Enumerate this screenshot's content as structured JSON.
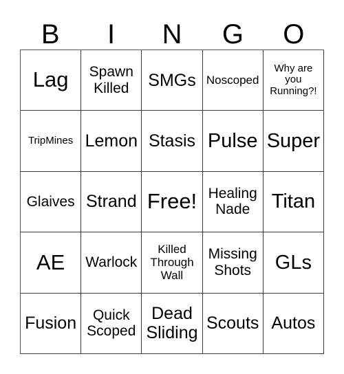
{
  "card": {
    "title": "BINGO",
    "header_letters": [
      "B",
      "I",
      "N",
      "G",
      "O"
    ],
    "colors": {
      "background": "#ffffff",
      "text": "#000000",
      "grid_line": "#3a3a3a"
    },
    "rows": 5,
    "columns": 5,
    "cells": [
      {
        "text": "Lag",
        "size": "fs-xxl"
      },
      {
        "text": "Spawn\nKilled",
        "size": "fs-md"
      },
      {
        "text": "SMGs",
        "size": "fs-lg"
      },
      {
        "text": "Noscoped",
        "size": "fs-sm"
      },
      {
        "text": "Why are\nyou\nRunning?!",
        "size": "fs-xs"
      },
      {
        "text": "TripMines",
        "size": "fs-xs"
      },
      {
        "text": "Lemon",
        "size": "fs-lg"
      },
      {
        "text": "Stasis",
        "size": "fs-lg"
      },
      {
        "text": "Pulse",
        "size": "fs-xl"
      },
      {
        "text": "Super",
        "size": "fs-xl"
      },
      {
        "text": "Glaives",
        "size": "fs-md"
      },
      {
        "text": "Strand",
        "size": "fs-lg"
      },
      {
        "text": "Free!",
        "size": "fs-xxl"
      },
      {
        "text": "Healing\nNade",
        "size": "fs-md"
      },
      {
        "text": "Titan",
        "size": "fs-xl"
      },
      {
        "text": "AE",
        "size": "fs-xxl"
      },
      {
        "text": "Warlock",
        "size": "fs-md"
      },
      {
        "text": "Killed\nThrough\nWall",
        "size": "fs-sm"
      },
      {
        "text": "Missing\nShots",
        "size": "fs-md"
      },
      {
        "text": "GLs",
        "size": "fs-xl"
      },
      {
        "text": "Fusion",
        "size": "fs-lg"
      },
      {
        "text": "Quick\nScoped",
        "size": "fs-md"
      },
      {
        "text": "Dead\nSliding",
        "size": "fs-lg"
      },
      {
        "text": "Scouts",
        "size": "fs-lg"
      },
      {
        "text": "Autos",
        "size": "fs-lg"
      }
    ]
  }
}
